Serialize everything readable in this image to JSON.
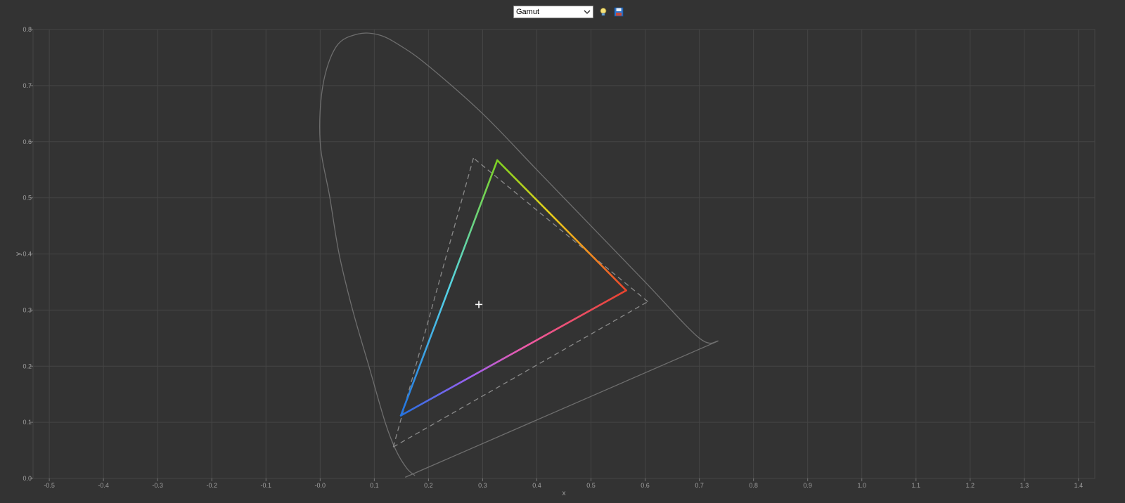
{
  "toolbar": {
    "mode_select_value": "Gamut",
    "icons": [
      "lightbulb-icon",
      "save-icon"
    ]
  },
  "chart_data": {
    "type": "line",
    "xlabel": "x",
    "ylabel": "y",
    "xlim": [
      -0.53,
      1.43
    ],
    "ylim": [
      0.0,
      0.8
    ],
    "x_ticks": [
      "-0.5",
      "-0.4",
      "-0.3",
      "-0.2",
      "-0.1",
      "-0.0",
      "0.1",
      "0.2",
      "0.3",
      "0.4",
      "0.5",
      "0.6",
      "0.7",
      "0.8",
      "0.9",
      "1.0",
      "1.1",
      "1.2",
      "1.3",
      "1.4"
    ],
    "y_ticks": [
      "0.0",
      "0.1",
      "0.2",
      "0.3",
      "0.4",
      "0.5",
      "0.6",
      "0.7",
      "0.8"
    ],
    "grid": true,
    "spectral_locus": [
      [
        0.175,
        0.005
      ],
      [
        0.16,
        0.018
      ],
      [
        0.14,
        0.05
      ],
      [
        0.12,
        0.1
      ],
      [
        0.09,
        0.2
      ],
      [
        0.06,
        0.3
      ],
      [
        0.035,
        0.4
      ],
      [
        0.018,
        0.5
      ],
      [
        0.0,
        0.6
      ],
      [
        0.005,
        0.7
      ],
      [
        0.03,
        0.77
      ],
      [
        0.07,
        0.792
      ],
      [
        0.11,
        0.79
      ],
      [
        0.15,
        0.77
      ],
      [
        0.2,
        0.735
      ],
      [
        0.3,
        0.65
      ],
      [
        0.4,
        0.55
      ],
      [
        0.5,
        0.45
      ],
      [
        0.6,
        0.35
      ],
      [
        0.7,
        0.25
      ],
      [
        0.735,
        0.245
      ]
    ],
    "purple_line": [
      [
        0.735,
        0.245
      ],
      [
        0.157,
        0.002
      ]
    ],
    "gamut_triangle": {
      "red": [
        0.565,
        0.335
      ],
      "green": [
        0.327,
        0.567
      ],
      "blue": [
        0.149,
        0.112
      ]
    },
    "reference_triangle": {
      "red": [
        0.605,
        0.315
      ],
      "green": [
        0.283,
        0.571
      ],
      "blue": [
        0.135,
        0.056
      ]
    },
    "white_point": [
      0.293,
      0.31
    ],
    "colors": {
      "background": "#333333",
      "grid": "#454545",
      "locus": "#6e6e6e",
      "reference": "#8a8a8a",
      "red": "#e8432c",
      "orange": "#f0901e",
      "yellow": "#e8d21a",
      "green": "#7ed321",
      "cyan": "#56d4e6",
      "blue": "#2272e0",
      "violet": "#9a60f0",
      "magenta": "#ee5aa8",
      "white": "#ffffff"
    }
  }
}
